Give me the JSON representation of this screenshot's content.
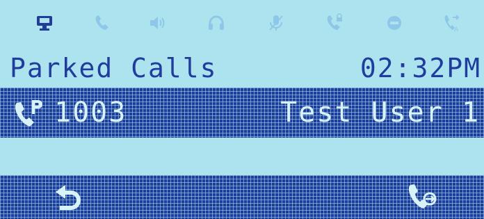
{
  "status_bar": {
    "icons": [
      {
        "name": "network-icon",
        "active": true
      },
      {
        "name": "handset-icon",
        "active": false
      },
      {
        "name": "speaker-icon",
        "active": false
      },
      {
        "name": "headset-icon",
        "active": false
      },
      {
        "name": "mute-icon",
        "active": false
      },
      {
        "name": "call-lock-icon",
        "active": false
      },
      {
        "name": "dnd-icon",
        "active": false
      },
      {
        "name": "auto-answer-icon",
        "active": false
      }
    ],
    "active_color": "#1f3d9c",
    "inactive_color": "#8fc7e8"
  },
  "header": {
    "title": "Parked Calls",
    "time": "02:32PM"
  },
  "parked_calls": [
    {
      "number": "1003",
      "name": "Test User 1",
      "icon": "parked-call-icon"
    }
  ],
  "softkeys": {
    "left": "back-arrow-icon",
    "right": "pickup-call-icon"
  },
  "colors": {
    "screen_background": "#ade3ee",
    "highlight_band": "#1f3d9c",
    "highlight_text": "#d7f2f8"
  }
}
